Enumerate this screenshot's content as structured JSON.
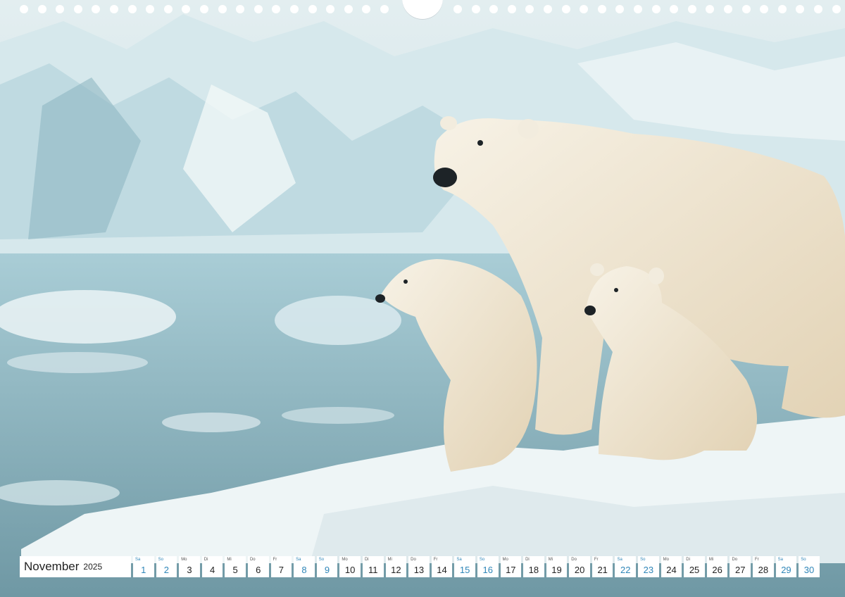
{
  "calendar": {
    "month": "November",
    "year": "2025",
    "days": [
      {
        "wd": "Sa",
        "num": "1",
        "weekend": true
      },
      {
        "wd": "So",
        "num": "2",
        "weekend": true
      },
      {
        "wd": "Mo",
        "num": "3",
        "weekend": false
      },
      {
        "wd": "Di",
        "num": "4",
        "weekend": false
      },
      {
        "wd": "Mi",
        "num": "5",
        "weekend": false
      },
      {
        "wd": "Do",
        "num": "6",
        "weekend": false
      },
      {
        "wd": "Fr",
        "num": "7",
        "weekend": false
      },
      {
        "wd": "Sa",
        "num": "8",
        "weekend": true
      },
      {
        "wd": "So",
        "num": "9",
        "weekend": true
      },
      {
        "wd": "Mo",
        "num": "10",
        "weekend": false
      },
      {
        "wd": "Di",
        "num": "11",
        "weekend": false
      },
      {
        "wd": "Mi",
        "num": "12",
        "weekend": false
      },
      {
        "wd": "Do",
        "num": "13",
        "weekend": false
      },
      {
        "wd": "Fr",
        "num": "14",
        "weekend": false
      },
      {
        "wd": "Sa",
        "num": "15",
        "weekend": true
      },
      {
        "wd": "So",
        "num": "16",
        "weekend": true
      },
      {
        "wd": "Mo",
        "num": "17",
        "weekend": false
      },
      {
        "wd": "Di",
        "num": "18",
        "weekend": false
      },
      {
        "wd": "Mi",
        "num": "19",
        "weekend": false
      },
      {
        "wd": "Do",
        "num": "20",
        "weekend": false
      },
      {
        "wd": "Fr",
        "num": "21",
        "weekend": false
      },
      {
        "wd": "Sa",
        "num": "22",
        "weekend": true
      },
      {
        "wd": "So",
        "num": "23",
        "weekend": true
      },
      {
        "wd": "Mo",
        "num": "24",
        "weekend": false
      },
      {
        "wd": "Di",
        "num": "25",
        "weekend": false
      },
      {
        "wd": "Mi",
        "num": "26",
        "weekend": false
      },
      {
        "wd": "Do",
        "num": "27",
        "weekend": false
      },
      {
        "wd": "Fr",
        "num": "28",
        "weekend": false
      },
      {
        "wd": "Sa",
        "num": "29",
        "weekend": true
      },
      {
        "wd": "So",
        "num": "30",
        "weekend": true
      }
    ]
  },
  "colors": {
    "weekend": "#2f86b8",
    "weekday": "#222222",
    "strip_background": "#ffffff"
  },
  "photo": {
    "subject_icon": "polar-bear-family-illustration"
  }
}
